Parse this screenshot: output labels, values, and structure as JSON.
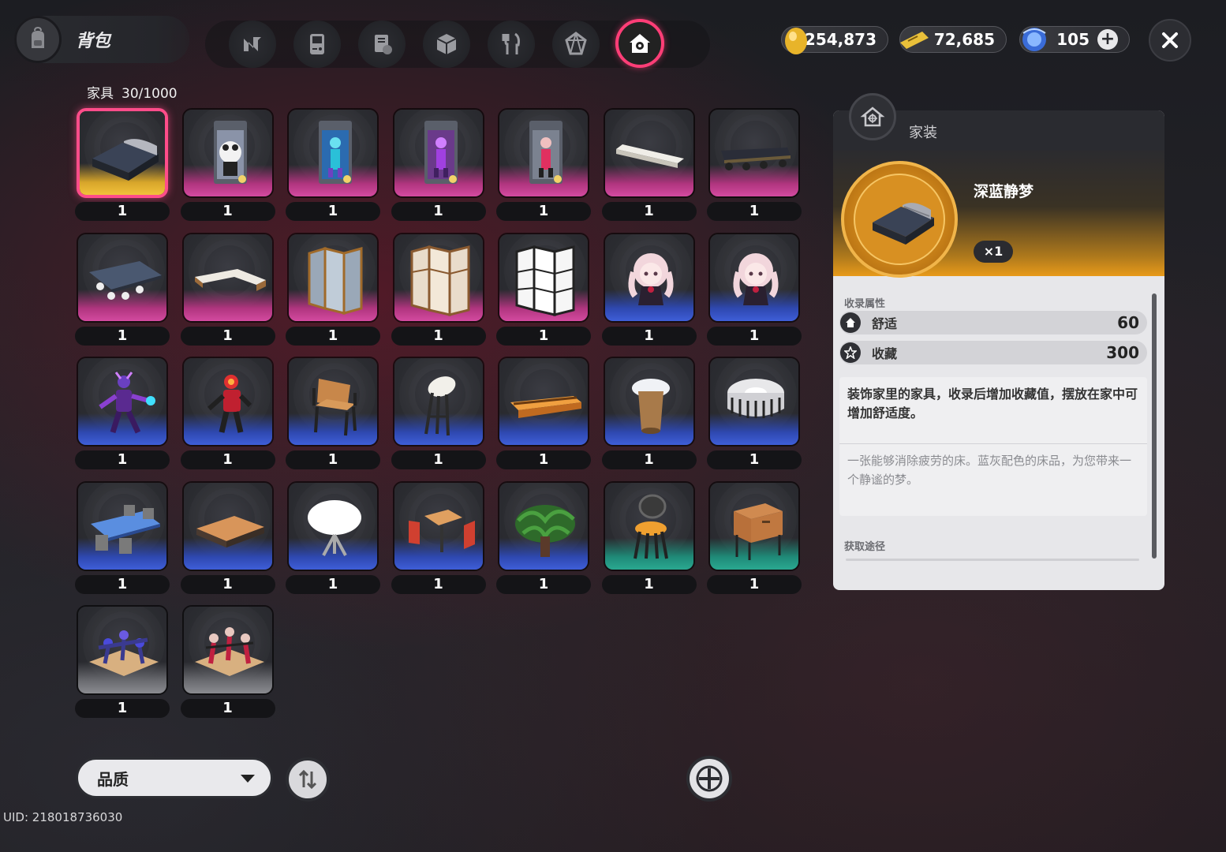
{
  "header": {
    "title": "背包",
    "tabs": [
      {
        "icon": "n-logo-icon"
      },
      {
        "icon": "gameboy-icon"
      },
      {
        "icon": "book-icon"
      },
      {
        "icon": "box-icon"
      },
      {
        "icon": "fork-knife-icon"
      },
      {
        "icon": "crystal-icon"
      },
      {
        "icon": "house-icon",
        "active": true
      }
    ]
  },
  "currencies": [
    {
      "icon": "gold-egg-icon",
      "value": "254,873"
    },
    {
      "icon": "ticket-icon",
      "value": "72,685"
    },
    {
      "icon": "blue-orb-icon",
      "value": "105",
      "addable": true
    }
  ],
  "inventory": {
    "category": "家具",
    "capacity": "30/1000",
    "items": [
      {
        "art": "bed",
        "quality": "gold",
        "count": "1",
        "selected": true
      },
      {
        "art": "card-panda",
        "quality": "pink",
        "count": "1"
      },
      {
        "art": "card-hero-blue",
        "quality": "pink",
        "count": "1"
      },
      {
        "art": "card-hero-purple",
        "quality": "pink",
        "count": "1"
      },
      {
        "art": "card-hero-red",
        "quality": "pink",
        "count": "1"
      },
      {
        "art": "plank",
        "quality": "pink",
        "count": "1"
      },
      {
        "art": "table-black",
        "quality": "pink",
        "count": "1"
      },
      {
        "art": "long-table",
        "quality": "pink",
        "count": "1"
      },
      {
        "art": "l-counter",
        "quality": "pink",
        "count": "1"
      },
      {
        "art": "screen-glass",
        "quality": "pink",
        "count": "1"
      },
      {
        "art": "screen-paper",
        "quality": "pink",
        "count": "1"
      },
      {
        "art": "screen-white",
        "quality": "pink",
        "count": "1"
      },
      {
        "art": "doll-girl",
        "quality": "blue",
        "count": "1"
      },
      {
        "art": "doll-girl",
        "quality": "blue",
        "count": "1"
      },
      {
        "art": "figure-purple",
        "quality": "blue",
        "count": "1"
      },
      {
        "art": "figure-red",
        "quality": "blue",
        "count": "1"
      },
      {
        "art": "armchair",
        "quality": "blue",
        "count": "1"
      },
      {
        "art": "bar-stool",
        "quality": "blue",
        "count": "1"
      },
      {
        "art": "planter-box",
        "quality": "blue",
        "count": "1"
      },
      {
        "art": "round-table",
        "quality": "blue",
        "count": "1"
      },
      {
        "art": "pouf",
        "quality": "blue",
        "count": "1"
      },
      {
        "art": "dining-table-blue",
        "quality": "blue",
        "count": "1"
      },
      {
        "art": "wood-platform",
        "quality": "blue",
        "count": "1"
      },
      {
        "art": "white-table",
        "quality": "blue",
        "count": "1"
      },
      {
        "art": "cafe-set",
        "quality": "blue",
        "count": "1"
      },
      {
        "art": "plant",
        "quality": "blue",
        "count": "1"
      },
      {
        "art": "chair-green",
        "quality": "green",
        "count": "1"
      },
      {
        "art": "nightstand",
        "quality": "green",
        "count": "1"
      },
      {
        "art": "diorama-blue",
        "quality": "grey",
        "count": "1"
      },
      {
        "art": "diorama-red",
        "quality": "grey",
        "count": "1"
      }
    ]
  },
  "controls": {
    "sort_label": "品质",
    "uid": "UID: 218018736030"
  },
  "detail": {
    "kind": "家装",
    "name": "深蓝静梦",
    "qty": "×1",
    "attr_label": "收录属性",
    "stats": [
      {
        "icon": "home-icon",
        "name": "舒适",
        "value": "60"
      },
      {
        "icon": "star-icon",
        "name": "收藏",
        "value": "300"
      }
    ],
    "description": "装饰家里的家具，收录后增加收藏值，摆放在家中可增加舒适度。",
    "flavor": "一张能够消除疲劳的床。蓝灰配色的床品，为您带来一个静谧的梦。",
    "source_label": "获取途径"
  },
  "colors": {
    "accent_pink": "#ff3e77",
    "gold": "#f2c23a",
    "pink": "#d44aa0",
    "blue": "#3e5ed8",
    "green": "#2aa890",
    "grey": "#8a8b90"
  }
}
